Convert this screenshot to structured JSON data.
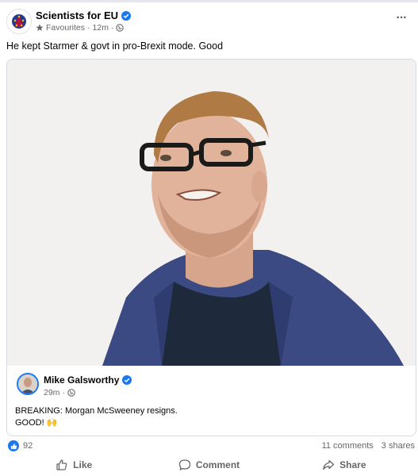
{
  "post": {
    "page_name": "Scientists for EU",
    "audience": "Favourites",
    "separator": "·",
    "time": "12m",
    "caption": "He kept Starmer & govt in pro-Brexit mode. Good",
    "more_icon": "more-horizontal-icon"
  },
  "shared": {
    "author": "Mike Galsworthy",
    "time": "29m",
    "line1": "BREAKING: Morgan McSweeney resigns.",
    "line2": "GOOD! 🙌"
  },
  "stats": {
    "reactions_count": "92",
    "comments": "11 comments",
    "shares": "3 shares"
  },
  "actions": {
    "like": "Like",
    "comment": "Comment",
    "share": "Share"
  },
  "colors": {
    "accent": "#1877f2",
    "muted_text": "#65676b",
    "text": "#050505",
    "border": "#d6d9dd"
  }
}
